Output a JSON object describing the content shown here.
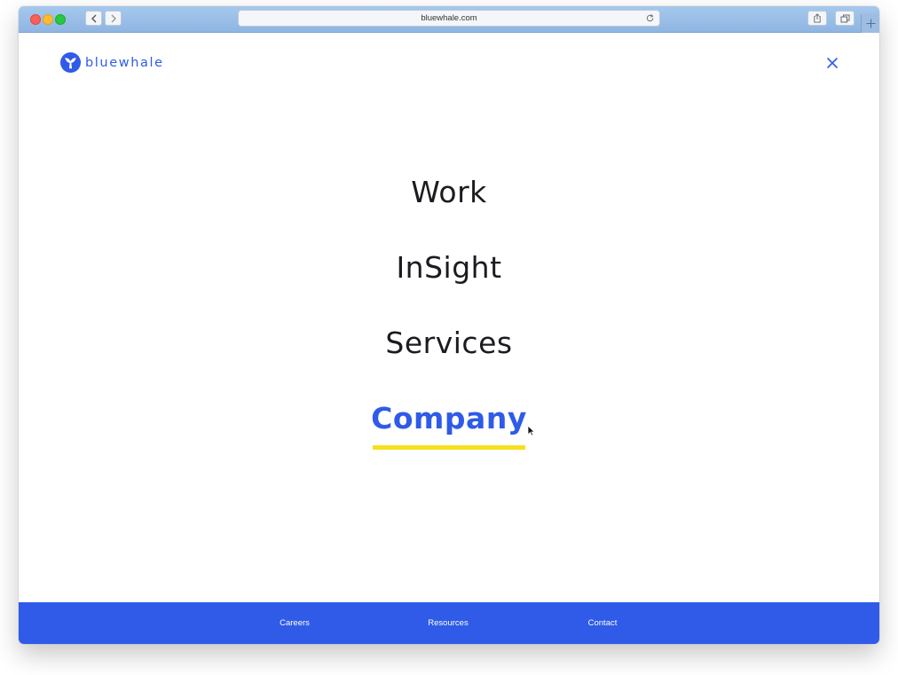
{
  "browser": {
    "url": "bluewhale.com"
  },
  "header": {
    "logo_text": "bluewhale"
  },
  "menu": {
    "items": [
      {
        "label": "Work",
        "active": false
      },
      {
        "label": "InSight",
        "active": false
      },
      {
        "label": "Services",
        "active": false
      },
      {
        "label": "Company",
        "active": true
      }
    ]
  },
  "footer": {
    "links": [
      "Careers",
      "Resources",
      "Contact"
    ]
  },
  "colors": {
    "brand_blue": "#2f5be8",
    "accent_yellow": "#f7df1e",
    "text_dark": "#1b1b20"
  },
  "icons": {
    "logo": "whale-tail-icon",
    "close": "close-icon",
    "back": "chevron-left-icon",
    "forward": "chevron-right-icon",
    "reload": "reload-icon",
    "share": "share-icon",
    "tabs": "tabs-icon",
    "new_tab": "plus-icon"
  }
}
